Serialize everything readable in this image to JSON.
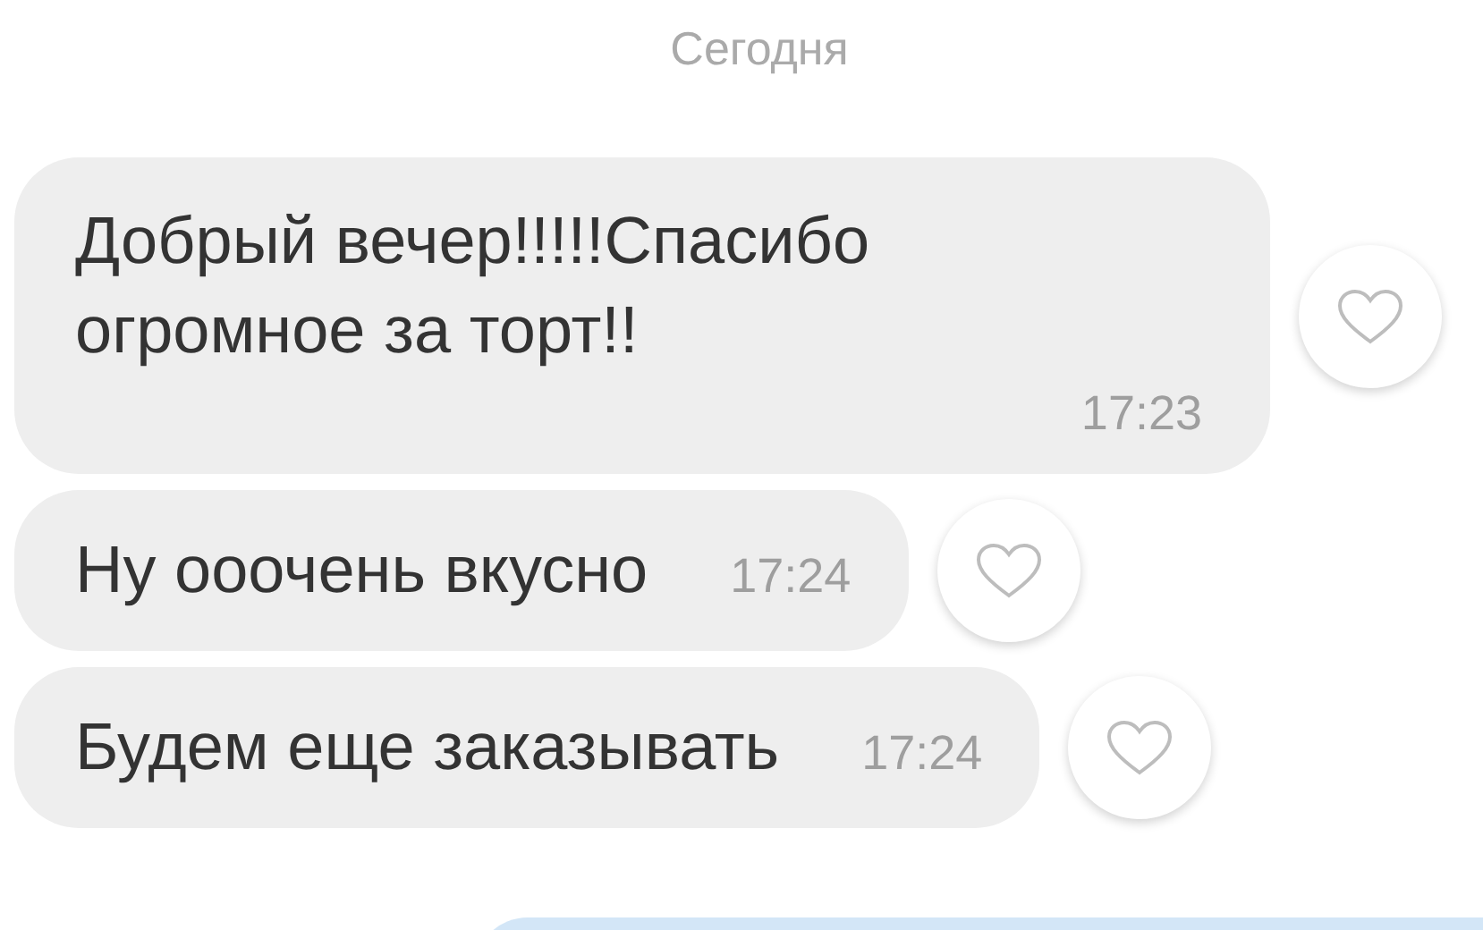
{
  "date_label": "Сегодня",
  "messages": [
    {
      "kind": "stacked",
      "text": "Добрый вечер!!!!!Спасибо огромное за торт!!",
      "time": "17:23",
      "liked": false
    },
    {
      "kind": "inline",
      "text": "Ну ооочень вкусно",
      "time": "17:24",
      "liked": false
    },
    {
      "kind": "inline",
      "text": "Будем еще заказывать",
      "time": "17:24",
      "liked": false
    }
  ]
}
